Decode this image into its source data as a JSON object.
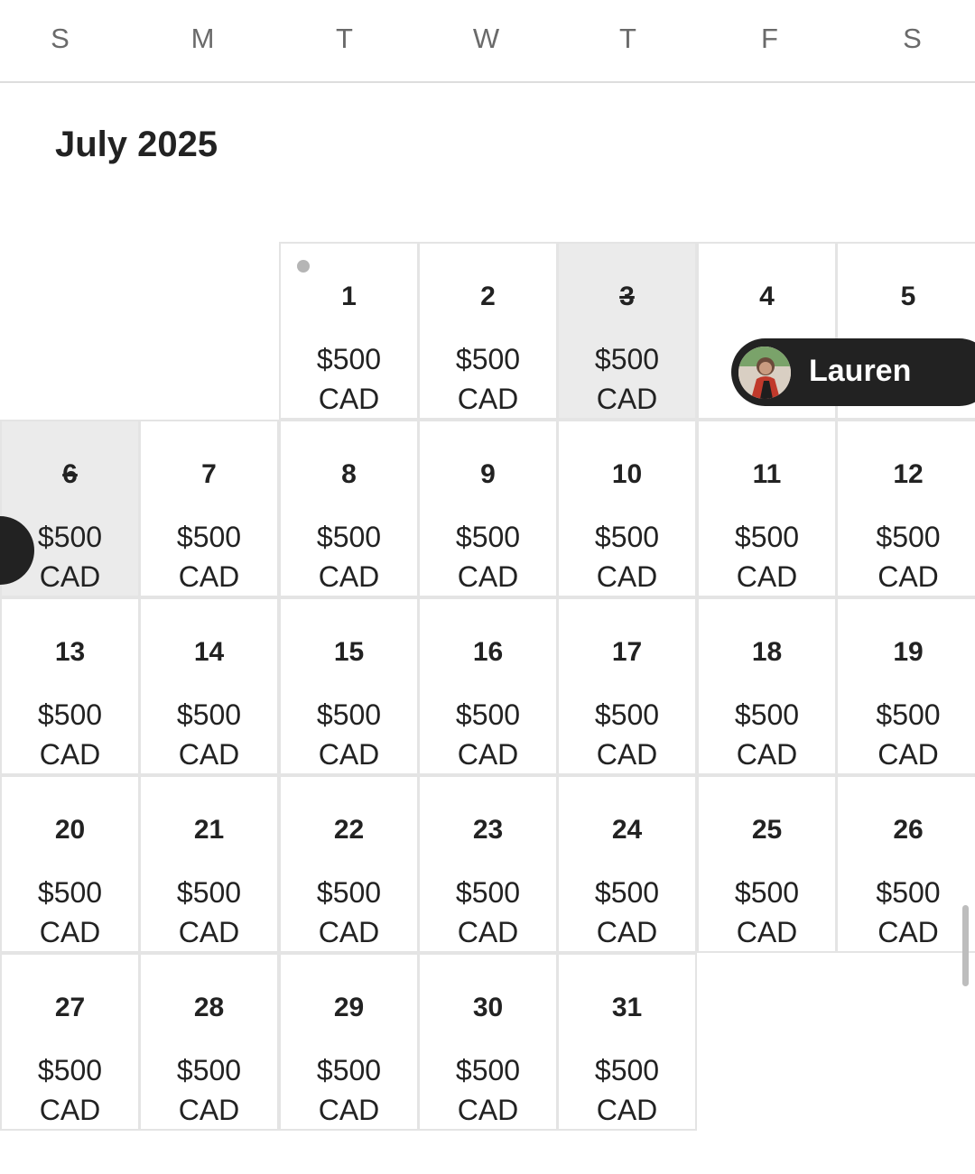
{
  "weekdays": [
    "S",
    "M",
    "T",
    "W",
    "T",
    "F",
    "S"
  ],
  "month_title": "July 2025",
  "days": [
    {
      "day": "1",
      "price": "$500",
      "currency": "CAD",
      "blocked": false,
      "today": true
    },
    {
      "day": "2",
      "price": "$500",
      "currency": "CAD",
      "blocked": false
    },
    {
      "day": "3",
      "price": "$500",
      "currency": "CAD",
      "blocked": true
    },
    {
      "day": "4",
      "price": "",
      "currency": "",
      "blocked": false
    },
    {
      "day": "5",
      "price": "",
      "currency": "",
      "blocked": false
    },
    {
      "day": "6",
      "price": "$500",
      "currency": "CAD",
      "blocked": true
    },
    {
      "day": "7",
      "price": "$500",
      "currency": "CAD",
      "blocked": false
    },
    {
      "day": "8",
      "price": "$500",
      "currency": "CAD",
      "blocked": false
    },
    {
      "day": "9",
      "price": "$500",
      "currency": "CAD",
      "blocked": false
    },
    {
      "day": "10",
      "price": "$500",
      "currency": "CAD",
      "blocked": false
    },
    {
      "day": "11",
      "price": "$500",
      "currency": "CAD",
      "blocked": false
    },
    {
      "day": "12",
      "price": "$500",
      "currency": "CAD",
      "blocked": false
    },
    {
      "day": "13",
      "price": "$500",
      "currency": "CAD",
      "blocked": false
    },
    {
      "day": "14",
      "price": "$500",
      "currency": "CAD",
      "blocked": false
    },
    {
      "day": "15",
      "price": "$500",
      "currency": "CAD",
      "blocked": false
    },
    {
      "day": "16",
      "price": "$500",
      "currency": "CAD",
      "blocked": false
    },
    {
      "day": "17",
      "price": "$500",
      "currency": "CAD",
      "blocked": false
    },
    {
      "day": "18",
      "price": "$500",
      "currency": "CAD",
      "blocked": false
    },
    {
      "day": "19",
      "price": "$500",
      "currency": "CAD",
      "blocked": false
    },
    {
      "day": "20",
      "price": "$500",
      "currency": "CAD",
      "blocked": false
    },
    {
      "day": "21",
      "price": "$500",
      "currency": "CAD",
      "blocked": false
    },
    {
      "day": "22",
      "price": "$500",
      "currency": "CAD",
      "blocked": false
    },
    {
      "day": "23",
      "price": "$500",
      "currency": "CAD",
      "blocked": false
    },
    {
      "day": "24",
      "price": "$500",
      "currency": "CAD",
      "blocked": false
    },
    {
      "day": "25",
      "price": "$500",
      "currency": "CAD",
      "blocked": false
    },
    {
      "day": "26",
      "price": "$500",
      "currency": "CAD",
      "blocked": false
    },
    {
      "day": "27",
      "price": "$500",
      "currency": "CAD",
      "blocked": false
    },
    {
      "day": "28",
      "price": "$500",
      "currency": "CAD",
      "blocked": false
    },
    {
      "day": "29",
      "price": "$500",
      "currency": "CAD",
      "blocked": false
    },
    {
      "day": "30",
      "price": "$500",
      "currency": "CAD",
      "blocked": false
    },
    {
      "day": "31",
      "price": "$500",
      "currency": "CAD",
      "blocked": false
    }
  ],
  "reservation": {
    "guest_name": "Lauren",
    "avatar_icon": "guest-avatar-photo",
    "pill_color": "#222222"
  },
  "colors": {
    "blocked_bg": "#ebebeb",
    "today_dot": "#b5b5b5",
    "grid_border": "#e4e4e4"
  }
}
